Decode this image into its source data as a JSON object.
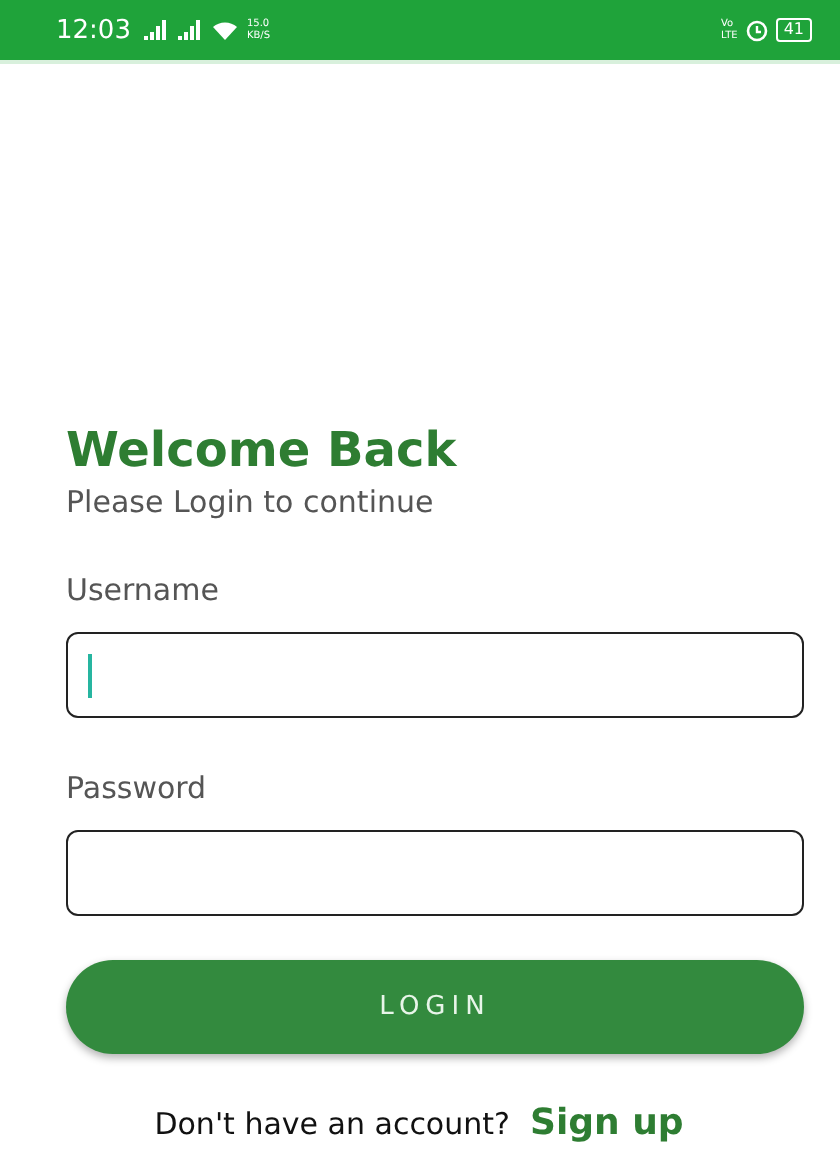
{
  "status_bar": {
    "time": "12:03",
    "speed_value": "15.0",
    "speed_unit": "KB/S",
    "volte_top": "Vo",
    "volte_bottom": "LTE",
    "battery": "41"
  },
  "title": "Welcome Back",
  "subtitle": "Please Login to continue",
  "fields": [
    {
      "label": "Username",
      "focused": true
    },
    {
      "label": "Password",
      "focused": false
    }
  ],
  "login_button": "LOGIN",
  "footer": {
    "prompt": "Don't have an account?",
    "link": "Sign up"
  }
}
